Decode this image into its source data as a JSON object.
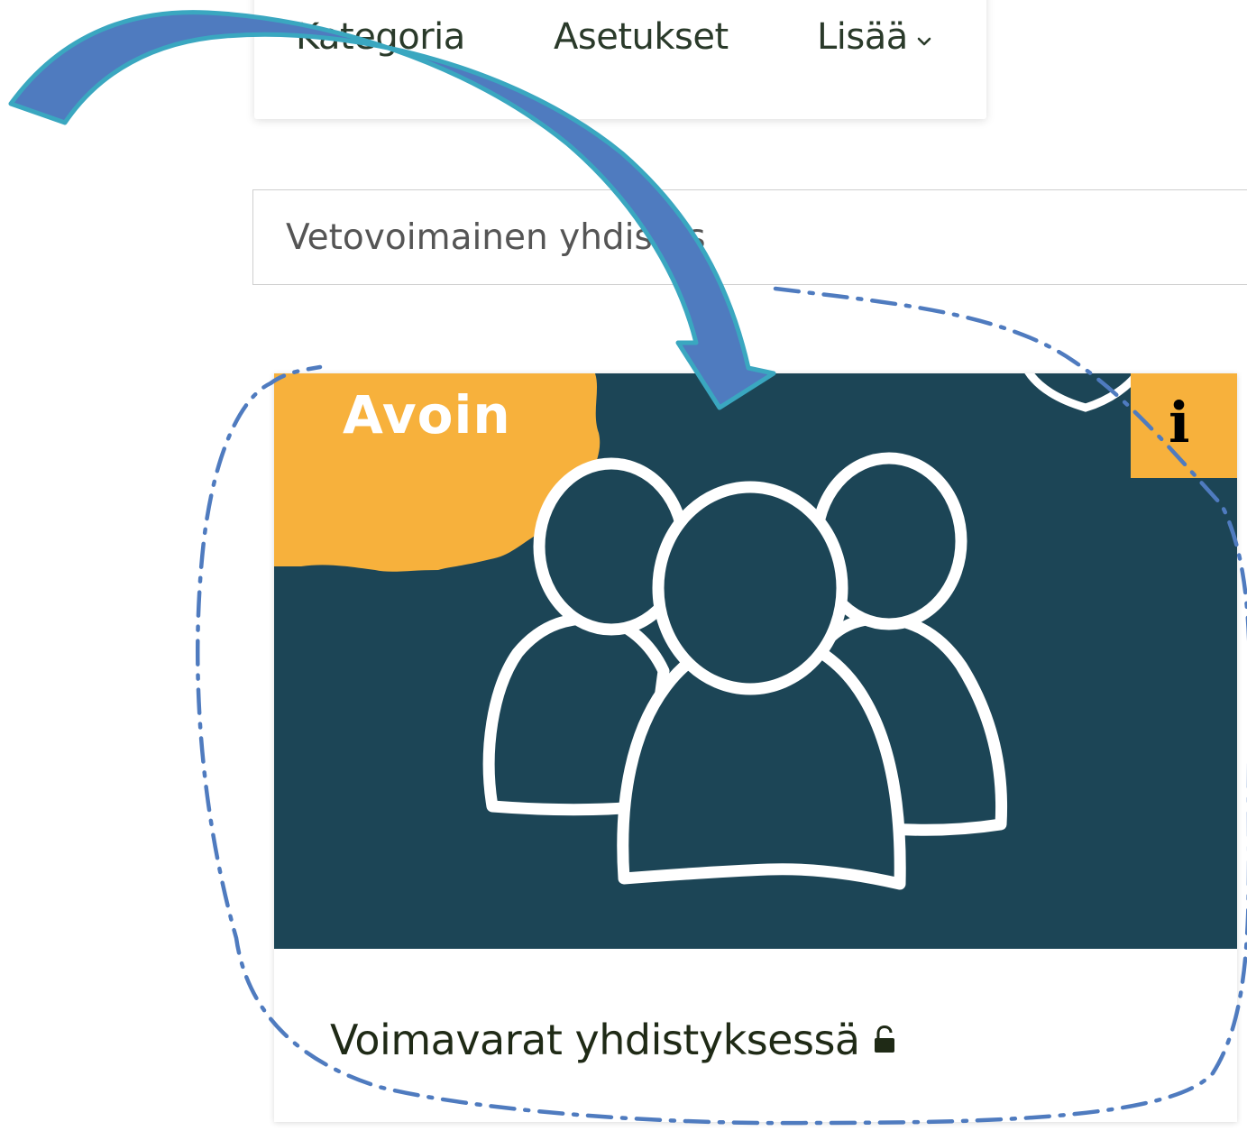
{
  "nav": {
    "items": [
      {
        "label": "Kategoria"
      },
      {
        "label": "Asetukset"
      },
      {
        "label": "Lisää"
      }
    ],
    "more_icon": "chevron-down-icon"
  },
  "title_input": {
    "value": "Vetovoimainen yhdistys"
  },
  "card": {
    "badge": "Avoin",
    "info_label": "i",
    "title": "Voimavarat yhdistyksessä",
    "title_icon": "unlock-icon",
    "image_icon": "group-people-icon",
    "colors": {
      "image_background": "#1c4556",
      "badge_accent": "#f7b13c"
    }
  },
  "annotations": {
    "arrow_color": "#4f7bbf",
    "arrow_outline": "#3aa7c0",
    "dashed_outline_color": "#4f7bbf"
  }
}
